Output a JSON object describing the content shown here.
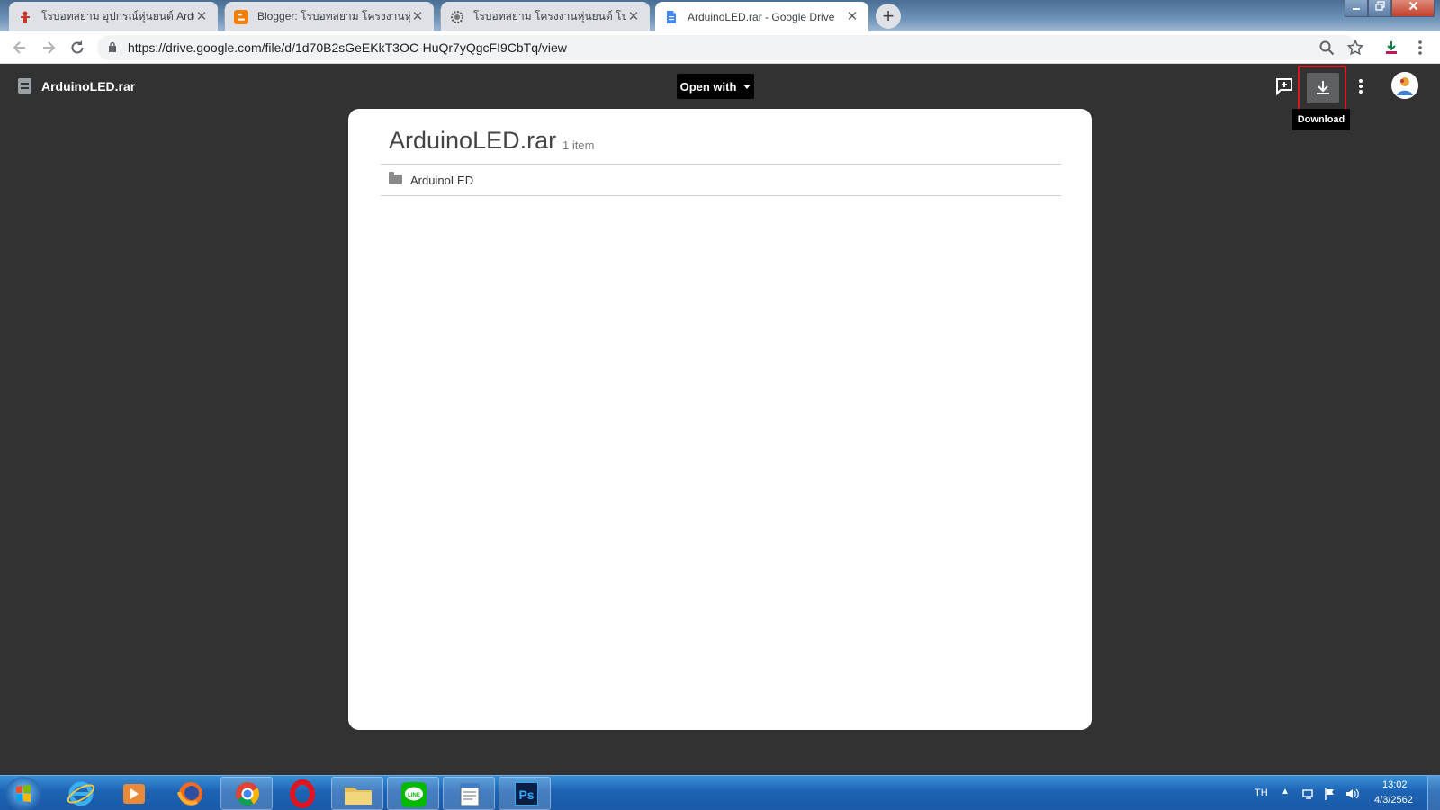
{
  "browser": {
    "tabs": [
      {
        "title": "โรบอทสยาม อุปกรณ์หุ่นยนต์ Arduino",
        "active": false,
        "favicon": "robot-favicon"
      },
      {
        "title": "Blogger: โรบอทสยาม โครงงานหุ่นยนต์",
        "active": false,
        "favicon": "blogger-favicon"
      },
      {
        "title": "โรบอทสยาม โครงงานหุ่นยนต์ โปรเจค",
        "active": false,
        "favicon": "gear-robot-favicon"
      },
      {
        "title": "ArduinoLED.rar - Google Drive",
        "active": true,
        "favicon": "drive-doc-favicon"
      }
    ],
    "new_tab_label": "+",
    "url": "https://drive.google.com/file/d/1d70B2sGeEKkT3OC-HuQr7yQgcFI9CbTq/view"
  },
  "viewer": {
    "file_name": "ArduinoLED.rar",
    "open_with_label": "Open with",
    "download_tooltip": "Download"
  },
  "archive": {
    "title": "ArduinoLED.rar",
    "count": "1 item",
    "items": [
      {
        "name": "ArduinoLED",
        "type": "folder"
      }
    ]
  },
  "taskbar": {
    "apps": [
      "internet-explorer",
      "media-player",
      "firefox",
      "chrome",
      "opera",
      "file-explorer",
      "line",
      "notepad",
      "photoshop"
    ],
    "photoshop_label": "Ps",
    "language": "TH",
    "time": "13:02",
    "date": "4/3/2562"
  },
  "colors": {
    "viewer_bg": "#323232",
    "highlight_box": "#e0141e",
    "taskbar": "#1d63b4"
  }
}
